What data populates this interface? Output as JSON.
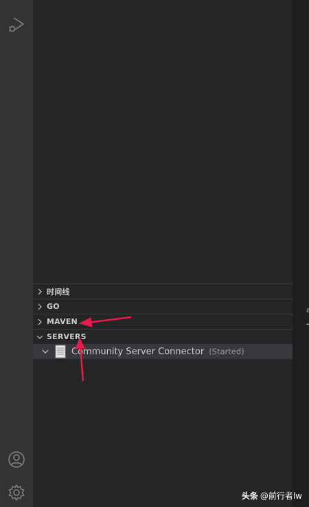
{
  "activity_bar": {
    "top_icons": [
      "run-and-debug-icon"
    ],
    "bottom_icons": [
      "account-icon",
      "settings-gear-icon"
    ]
  },
  "sidebar": {
    "sections": [
      {
        "label": "时间线",
        "expanded": false
      },
      {
        "label": "GO",
        "expanded": false
      },
      {
        "label": "MAVEN",
        "expanded": false
      },
      {
        "label": "SERVERS",
        "expanded": true
      }
    ],
    "servers": {
      "items": [
        {
          "name": "Community Server Connector",
          "status": "(Started)",
          "expanded": true
        }
      ]
    }
  },
  "annotations": {
    "arrow_color": "#e8194b",
    "targets": [
      "MAVEN",
      "SERVERS"
    ]
  },
  "watermark": {
    "brand": "头条",
    "handle": "@前行者lw"
  },
  "editor_edge": {
    "clipped_glyph": "a",
    "clipped_dash": "-"
  },
  "colors": {
    "activity_bar": "#333333",
    "sidebar": "#252526",
    "selected_row": "#37373d",
    "editor": "#1e1e1e"
  }
}
